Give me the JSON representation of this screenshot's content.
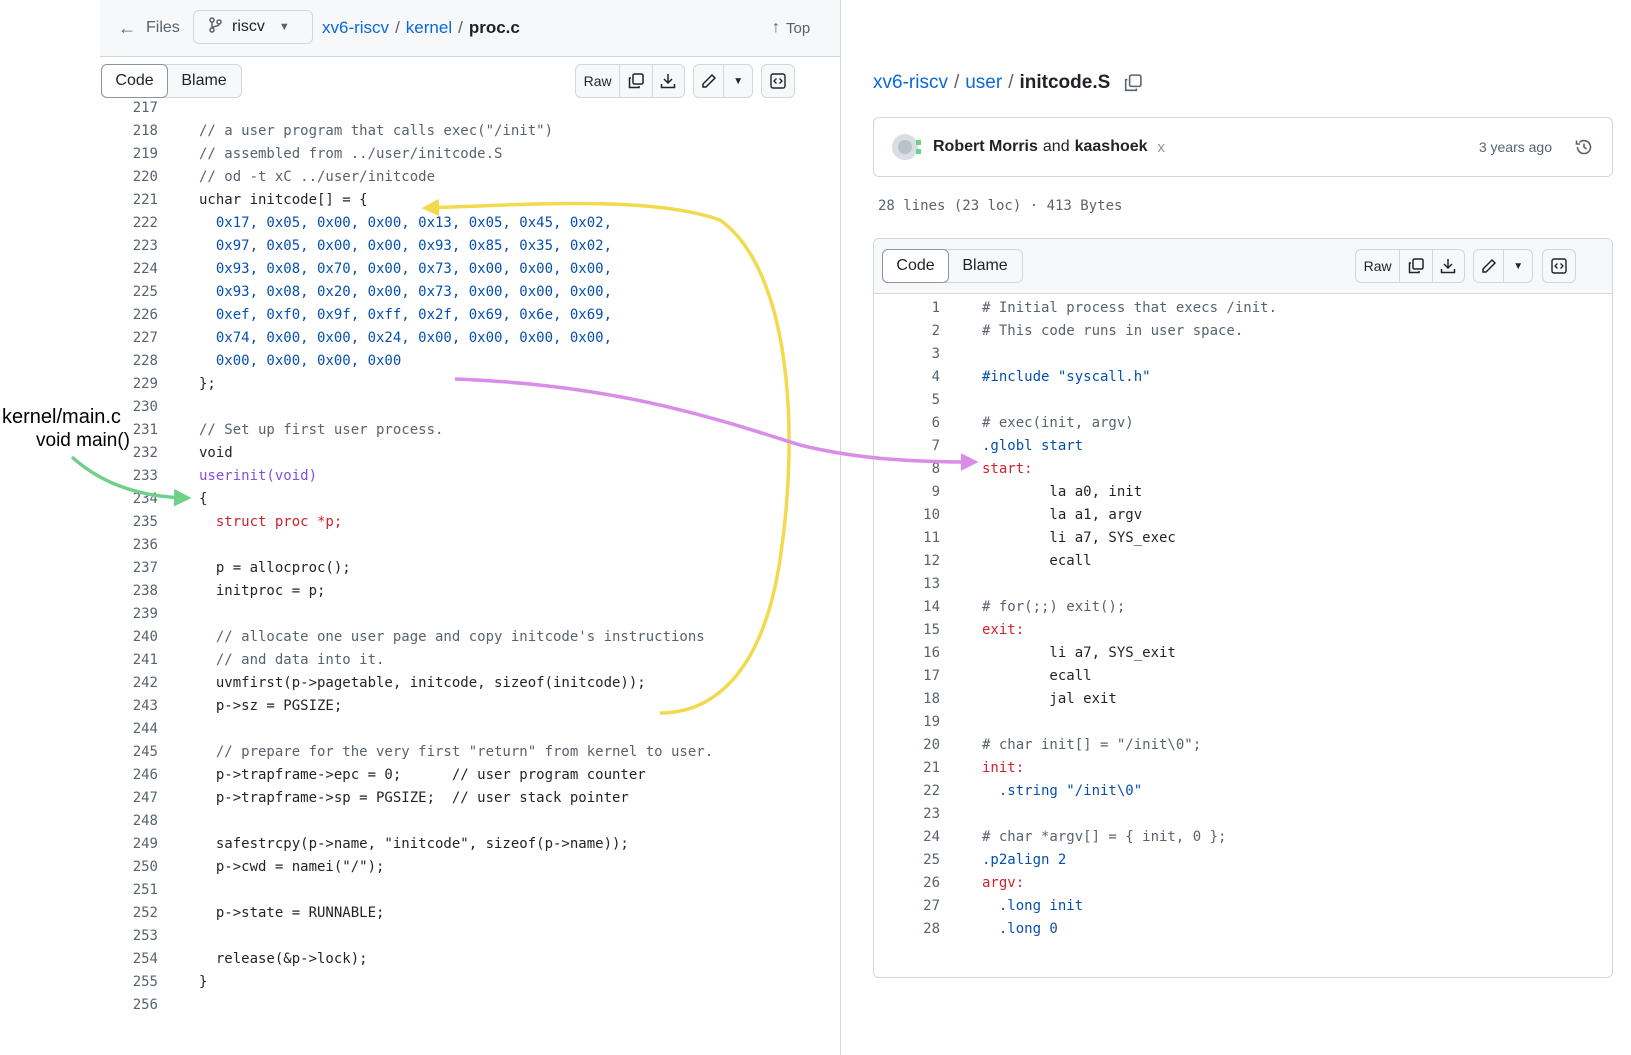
{
  "left": {
    "files_label": "Files",
    "branch": "riscv",
    "breadcrumb": {
      "repo": "xv6-riscv",
      "dir": "kernel",
      "file": "proc.c"
    },
    "top_label": "Top",
    "tabs": {
      "code": "Code",
      "blame": "Blame"
    },
    "raw_label": "Raw",
    "lines": [
      {
        "n": "217",
        "t": ""
      },
      {
        "n": "218",
        "t": "// a user program that calls exec(\"/init\")",
        "s": "com"
      },
      {
        "n": "219",
        "t": "// assembled from ../user/initcode.S",
        "s": "com"
      },
      {
        "n": "220",
        "t": "// od -t xC ../user/initcode",
        "s": "com"
      },
      {
        "n": "221",
        "t": "uchar initcode[] = {",
        "s": "txt"
      },
      {
        "n": "222",
        "t": "  0x17, 0x05, 0x00, 0x00, 0x13, 0x05, 0x45, 0x02,",
        "s": "num"
      },
      {
        "n": "223",
        "t": "  0x97, 0x05, 0x00, 0x00, 0x93, 0x85, 0x35, 0x02,",
        "s": "num"
      },
      {
        "n": "224",
        "t": "  0x93, 0x08, 0x70, 0x00, 0x73, 0x00, 0x00, 0x00,",
        "s": "num"
      },
      {
        "n": "225",
        "t": "  0x93, 0x08, 0x20, 0x00, 0x73, 0x00, 0x00, 0x00,",
        "s": "num"
      },
      {
        "n": "226",
        "t": "  0xef, 0xf0, 0x9f, 0xff, 0x2f, 0x69, 0x6e, 0x69,",
        "s": "num"
      },
      {
        "n": "227",
        "t": "  0x74, 0x00, 0x00, 0x24, 0x00, 0x00, 0x00, 0x00,",
        "s": "num"
      },
      {
        "n": "228",
        "t": "  0x00, 0x00, 0x00, 0x00",
        "s": "num"
      },
      {
        "n": "229",
        "t": "};",
        "s": "txt"
      },
      {
        "n": "230",
        "t": ""
      },
      {
        "n": "231",
        "t": "// Set up first user process.",
        "s": "com"
      },
      {
        "n": "232",
        "t": "void",
        "s": "txt"
      },
      {
        "n": "233",
        "t": "userinit(void)",
        "s": "fn"
      },
      {
        "n": "234",
        "t": "{",
        "s": "txt"
      },
      {
        "n": "235",
        "t": "  struct proc *p;",
        "s": "key"
      },
      {
        "n": "236",
        "t": ""
      },
      {
        "n": "237",
        "t": "  p = allocproc();",
        "s": "txt"
      },
      {
        "n": "238",
        "t": "  initproc = p;",
        "s": "txt"
      },
      {
        "n": "239",
        "t": ""
      },
      {
        "n": "240",
        "t": "  // allocate one user page and copy initcode's instructions",
        "s": "com"
      },
      {
        "n": "241",
        "t": "  // and data into it.",
        "s": "com"
      },
      {
        "n": "242",
        "t": "  uvmfirst(p->pagetable, initcode, sizeof(initcode));",
        "s": "txt"
      },
      {
        "n": "243",
        "t": "  p->sz = PGSIZE;",
        "s": "txt"
      },
      {
        "n": "244",
        "t": ""
      },
      {
        "n": "245",
        "t": "  // prepare for the very first \"return\" from kernel to user.",
        "s": "com"
      },
      {
        "n": "246",
        "t": "  p->trapframe->epc = 0;      // user program counter",
        "s": "txt"
      },
      {
        "n": "247",
        "t": "  p->trapframe->sp = PGSIZE;  // user stack pointer",
        "s": "txt"
      },
      {
        "n": "248",
        "t": ""
      },
      {
        "n": "249",
        "t": "  safestrcpy(p->name, \"initcode\", sizeof(p->name));",
        "s": "txt"
      },
      {
        "n": "250",
        "t": "  p->cwd = namei(\"/\");",
        "s": "txt"
      },
      {
        "n": "251",
        "t": ""
      },
      {
        "n": "252",
        "t": "  p->state = RUNNABLE;",
        "s": "txt"
      },
      {
        "n": "253",
        "t": ""
      },
      {
        "n": "254",
        "t": "  release(&p->lock);",
        "s": "txt"
      },
      {
        "n": "255",
        "t": "}",
        "s": "txt"
      },
      {
        "n": "256",
        "t": ""
      }
    ]
  },
  "right": {
    "breadcrumb": {
      "repo": "xv6-riscv",
      "dir": "user",
      "file": "initcode.S"
    },
    "commit": {
      "authors_a": "Robert Morris",
      "and": "and",
      "authors_b": "kaashoek",
      "status": "x",
      "time": "3 years ago"
    },
    "file_info": "28 lines (23 loc) · 413 Bytes",
    "tabs": {
      "code": "Code",
      "blame": "Blame"
    },
    "raw_label": "Raw",
    "lines": [
      {
        "n": "1",
        "t": "# Initial process that execs /init.",
        "s": "com"
      },
      {
        "n": "2",
        "t": "# This code runs in user space.",
        "s": "com"
      },
      {
        "n": "3",
        "t": ""
      },
      {
        "n": "4",
        "t": "#include \"syscall.h\"",
        "s": "inc"
      },
      {
        "n": "5",
        "t": ""
      },
      {
        "n": "6",
        "t": "# exec(init, argv)",
        "s": "com"
      },
      {
        "n": "7",
        "t": ".globl start",
        "s": "dir"
      },
      {
        "n": "8",
        "t": "start:",
        "s": "key"
      },
      {
        "n": "9",
        "t": "        la a0, init",
        "s": "txt"
      },
      {
        "n": "10",
        "t": "        la a1, argv",
        "s": "txt"
      },
      {
        "n": "11",
        "t": "        li a7, SYS_exec",
        "s": "txt"
      },
      {
        "n": "12",
        "t": "        ecall",
        "s": "txt"
      },
      {
        "n": "13",
        "t": ""
      },
      {
        "n": "14",
        "t": "# for(;;) exit();",
        "s": "com"
      },
      {
        "n": "15",
        "t": "exit:",
        "s": "key"
      },
      {
        "n": "16",
        "t": "        li a7, SYS_exit",
        "s": "txt"
      },
      {
        "n": "17",
        "t": "        ecall",
        "s": "txt"
      },
      {
        "n": "18",
        "t": "        jal exit",
        "s": "txt"
      },
      {
        "n": "19",
        "t": ""
      },
      {
        "n": "20",
        "t": "# char init[] = \"/init\\0\";",
        "s": "com"
      },
      {
        "n": "21",
        "t": "init:",
        "s": "key"
      },
      {
        "n": "22",
        "t": "  .string \"/init\\0\"",
        "s": "dirstr"
      },
      {
        "n": "23",
        "t": ""
      },
      {
        "n": "24",
        "t": "# char *argv[] = { init, 0 };",
        "s": "com"
      },
      {
        "n": "25",
        "t": ".p2align 2",
        "s": "dirnum"
      },
      {
        "n": "26",
        "t": "argv:",
        "s": "key"
      },
      {
        "n": "27",
        "t": "  .long init",
        "s": "dirtxt"
      },
      {
        "n": "28",
        "t": "  .long 0",
        "s": "dirnum"
      }
    ]
  },
  "annotations": {
    "file_label": "kernel/main.c",
    "func_label": "void main()"
  },
  "colors": {
    "yellow_arrow": "#f2d94e",
    "purple_arrow": "#d98ce8",
    "green_arrow": "#6fd08a"
  }
}
